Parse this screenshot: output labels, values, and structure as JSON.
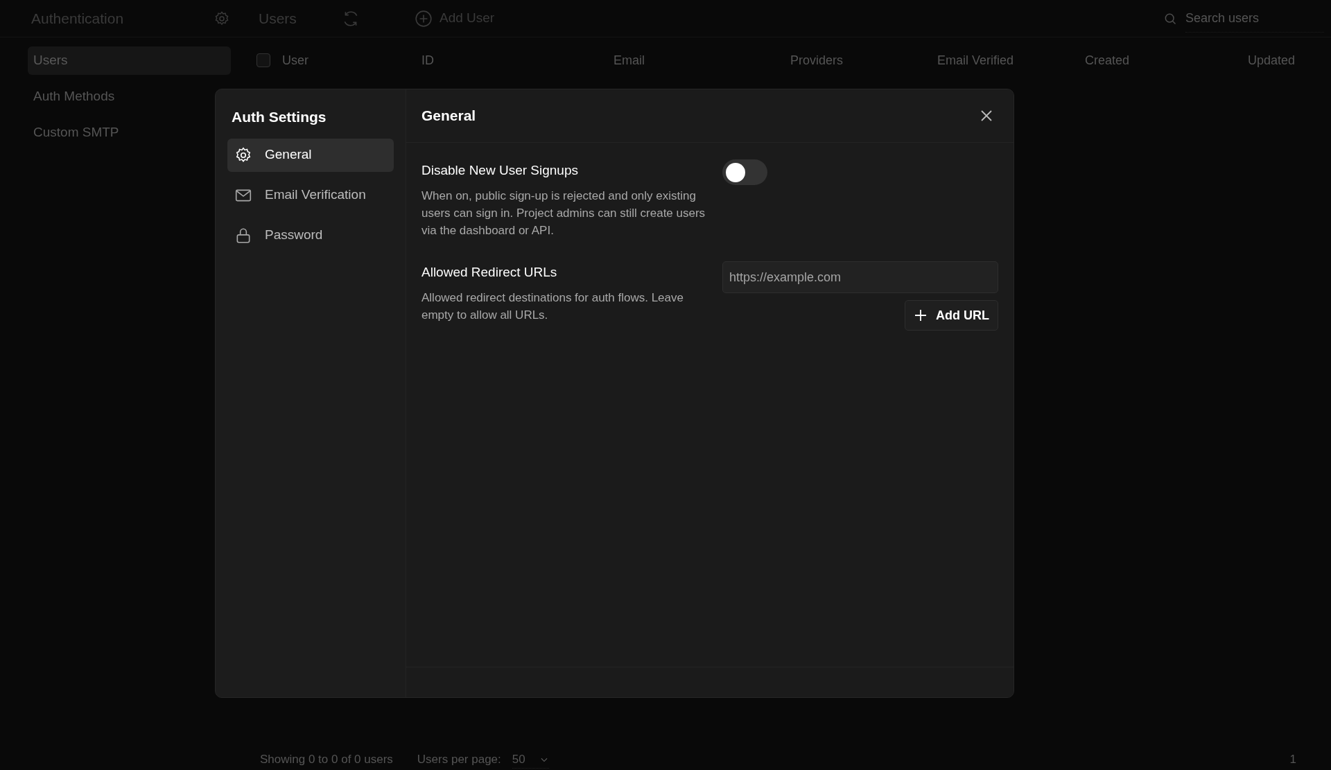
{
  "header": {
    "title": "Authentication",
    "section_title": "Users",
    "add_button": "Add User",
    "search": {
      "placeholder": "Search users"
    }
  },
  "sidebar": {
    "items": [
      {
        "label": "Users",
        "selected": true
      },
      {
        "label": "Auth Methods",
        "selected": false
      },
      {
        "label": "Custom SMTP",
        "selected": false
      }
    ]
  },
  "table": {
    "select_all_checked": false,
    "columns": [
      "User",
      "ID",
      "Email",
      "Providers",
      "Email Verified",
      "Created",
      "Updated"
    ]
  },
  "footer": {
    "summary": "Showing 0 to 0 of 0 users",
    "per_page_label": "Users per page:",
    "per_page_value": "50",
    "page": "1"
  },
  "modal": {
    "title": "Auth Settings",
    "heading": "General",
    "nav": [
      {
        "label": "General",
        "selected": true
      },
      {
        "label": "Email Verification",
        "selected": false
      },
      {
        "label": "Password",
        "selected": false
      }
    ],
    "settings": [
      {
        "kind": "toggle",
        "label": "Disable New User Signups",
        "description": "When on, public sign-up is rejected and only existing users can sign in. Project admins can still create users via the dashboard or API.",
        "on": false
      },
      {
        "kind": "url_list",
        "label": "Allowed Redirect URLs",
        "description": "Allowed redirect destinations for auth flows. Leave empty to allow all URLs.",
        "placeholder": "https://example.com",
        "button": "Add URL"
      }
    ]
  }
}
